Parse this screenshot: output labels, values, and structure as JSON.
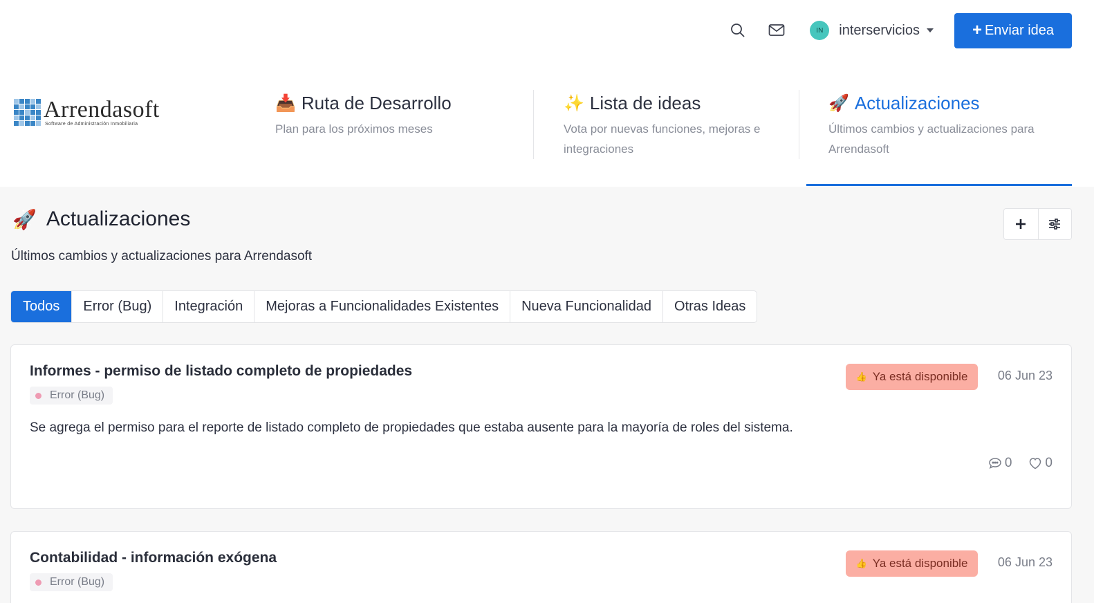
{
  "header": {
    "user": {
      "initials": "IN",
      "name": "interservicios"
    },
    "submit_label": "Enviar idea",
    "submit_icon": "plus-icon",
    "icons": [
      "search-icon",
      "mail-icon",
      "chevron-down-icon"
    ]
  },
  "logo": {
    "name": "Arrendasoft",
    "tagline": "Software de Administración Inmobiliaria"
  },
  "nav": [
    {
      "emoji": "📥",
      "title": "Ruta de Desarrollo",
      "description": "Plan para los próximos meses"
    },
    {
      "emoji": "✨",
      "title": "Lista de ideas",
      "description": "Vota por nuevas funciones, mejoras e integraciones"
    },
    {
      "emoji": "🚀",
      "title": "Actualizaciones",
      "description": "Últimos cambios y actualizaciones para Arrendasoft",
      "active": true
    }
  ],
  "page": {
    "emoji": "🚀",
    "title": "Actualizaciones",
    "description": "Últimos cambios y actualizaciones para Arrendasoft",
    "tools": [
      "plus-icon",
      "sliders-icon"
    ]
  },
  "filters": [
    "Todos",
    "Error (Bug)",
    "Integración",
    "Mejoras a Funcionalidades Existentes",
    "Nueva Funcionalidad",
    "Otras Ideas"
  ],
  "posts": [
    {
      "title": "Informes - permiso de listado completo de propiedades",
      "tag": "Error (Bug)",
      "status": "Ya está disponible",
      "status_emoji": "👍",
      "date": "06 Jun 23",
      "body": "Se agrega el permiso para el reporte de listado completo de propiedades que estaba ausente para la mayoría de roles del sistema.",
      "comments": "0",
      "likes": "0"
    },
    {
      "title": "Contabilidad - información exógena",
      "tag": "Error (Bug)",
      "status": "Ya está disponible",
      "status_emoji": "👍",
      "date": "06 Jun 23"
    }
  ],
  "colors": {
    "accent": "#1a6fdd",
    "status_bg": "#fbaea3",
    "tag_dot": "#ee9bb3",
    "avatar": "#47c6bd"
  }
}
